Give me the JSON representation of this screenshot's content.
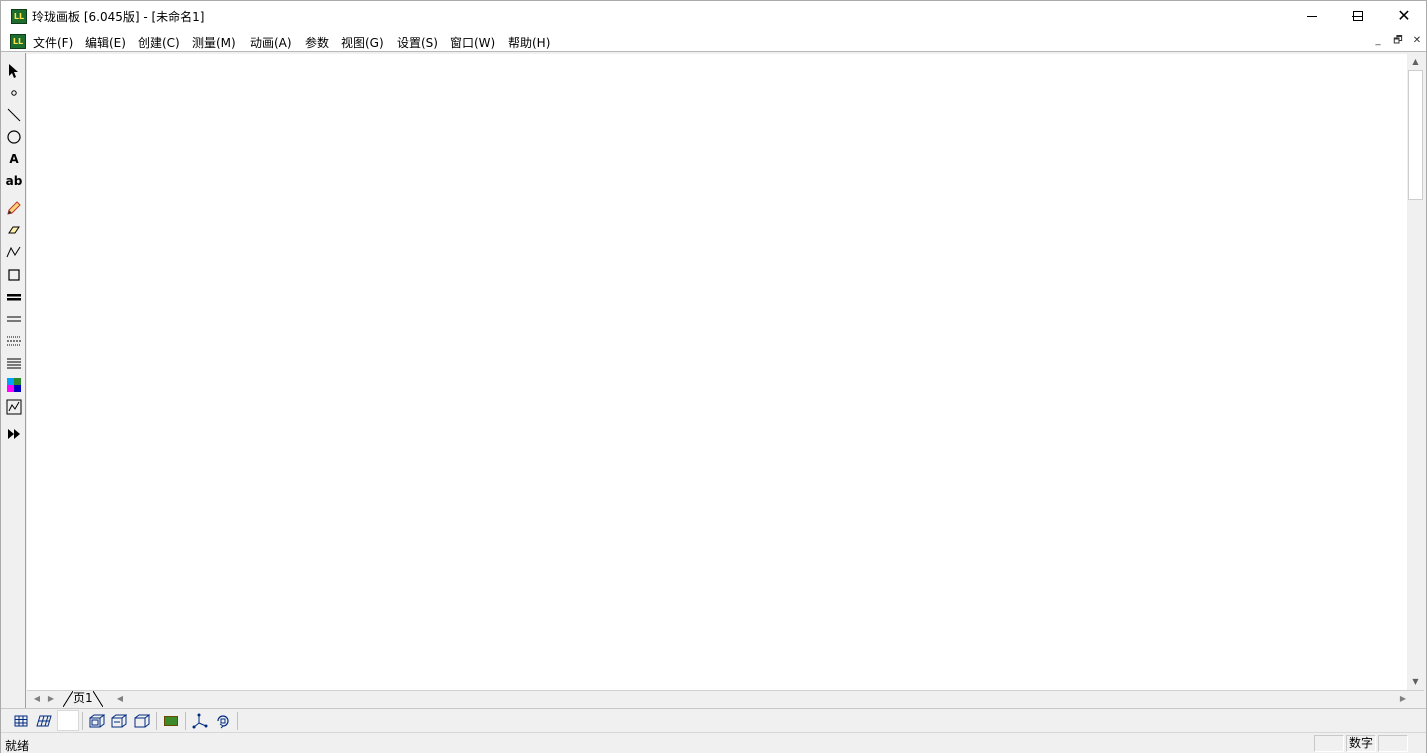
{
  "window": {
    "title": "玲珑画板 [6.045版] - [未命名1]",
    "app_icon_text": "LL",
    "controls": {
      "minimize": "minimize",
      "maximize": "maximize",
      "close": "✕"
    }
  },
  "menubar": {
    "items": [
      {
        "label": "文件(F)"
      },
      {
        "label": "编辑(E)"
      },
      {
        "label": "创建(C)"
      },
      {
        "label": "测量(M)"
      },
      {
        "label": "动画(A)"
      },
      {
        "label": "参数"
      },
      {
        "label": "视图(G)"
      },
      {
        "label": "设置(S)"
      },
      {
        "label": "窗口(W)"
      },
      {
        "label": "帮助(H)"
      }
    ],
    "mdi_controls": [
      "_",
      "🗗",
      "✕"
    ]
  },
  "toolbox": {
    "tools": [
      {
        "name": "select-arrow-icon"
      },
      {
        "name": "point-icon"
      },
      {
        "name": "line-icon"
      },
      {
        "name": "circle-icon"
      },
      {
        "name": "text-A-icon",
        "glyph": "A"
      },
      {
        "name": "text-ab-icon",
        "glyph": "ab"
      },
      {
        "name": "pencil-icon"
      },
      {
        "name": "eraser-icon"
      },
      {
        "name": "freehand-curve-icon"
      },
      {
        "name": "rectangle-icon"
      },
      {
        "name": "thick-line-icon"
      },
      {
        "name": "thin-line-icon"
      },
      {
        "name": "dotted-line-icon"
      },
      {
        "name": "multi-line-icon"
      },
      {
        "name": "color-palette-icon"
      },
      {
        "name": "graph-icon"
      },
      {
        "name": "fast-forward-icon"
      }
    ]
  },
  "pages": {
    "tabs": [
      {
        "label": "页1"
      }
    ]
  },
  "bottom_toolbar": {
    "tools": [
      "grid-icon",
      "parallelogram-grid-icon",
      "blank-button",
      "cube-front-icon",
      "cube-side-icon",
      "cube-outline-icon",
      "green-rect-icon",
      "axes-3d-icon",
      "rotate-3d-icon"
    ]
  },
  "statusbar": {
    "text": "就绪",
    "num_lock": "数字"
  },
  "colors": {
    "app_icon_bg": "#1d6d2f",
    "app_icon_fg": "#ffe14a",
    "canvas": "#ffffff",
    "chrome": "#f0f0f0"
  }
}
